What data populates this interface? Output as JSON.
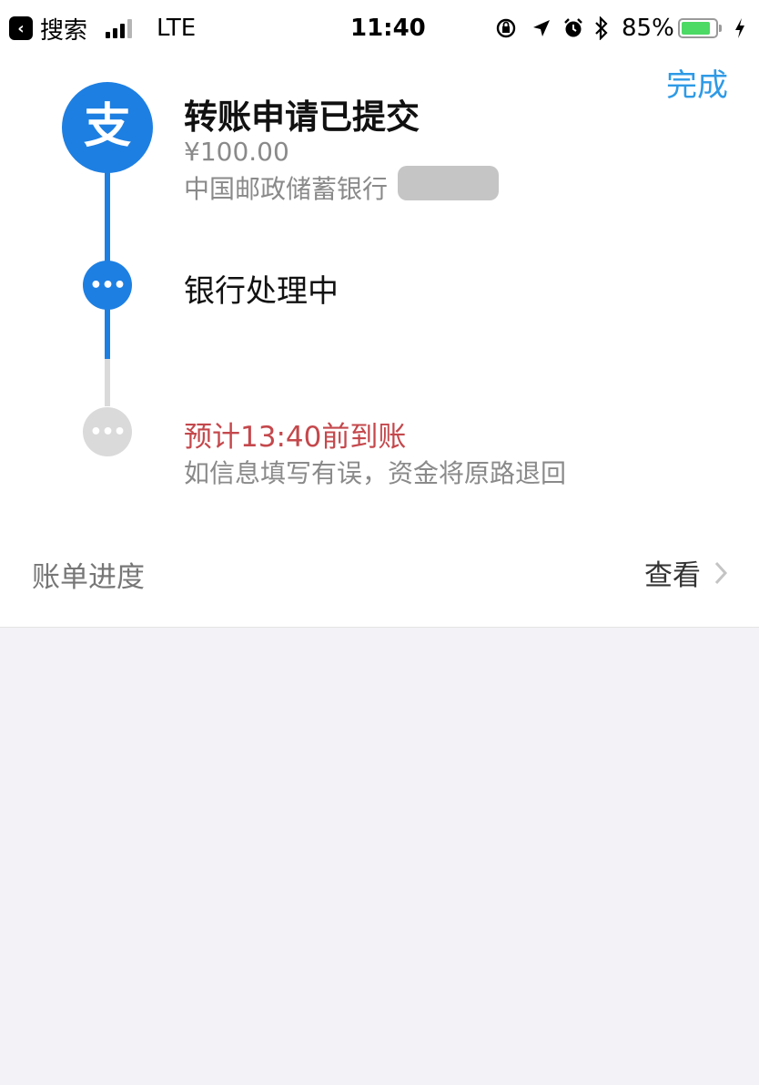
{
  "status_bar": {
    "back_label": "搜索",
    "network": "LTE",
    "time": "11:40",
    "battery_percent": "85%",
    "battery_level": 0.85,
    "icons": [
      "back-icon",
      "signal-icon",
      "orientation-lock-icon",
      "location-icon",
      "alarm-icon",
      "bluetooth-icon",
      "battery-icon",
      "charging-icon"
    ]
  },
  "header": {
    "done_label": "完成"
  },
  "timeline": {
    "step1": {
      "title": "转账申请已提交",
      "amount": "¥100.00",
      "bank": "中国邮政储蓄银行",
      "logo_char": "支"
    },
    "step2": {
      "title": "银行处理中"
    },
    "step3": {
      "title": "预计13:40前到账",
      "note": "如信息填写有误，资金将原路退回"
    }
  },
  "bill_progress": {
    "label": "账单进度",
    "link_label": "查看"
  },
  "colors": {
    "accent": "#1d7fe2",
    "link": "#2e9ae6",
    "eta_red": "#c4484c",
    "inactive": "#dadada",
    "bottom_bg": "#f2f2f7"
  }
}
